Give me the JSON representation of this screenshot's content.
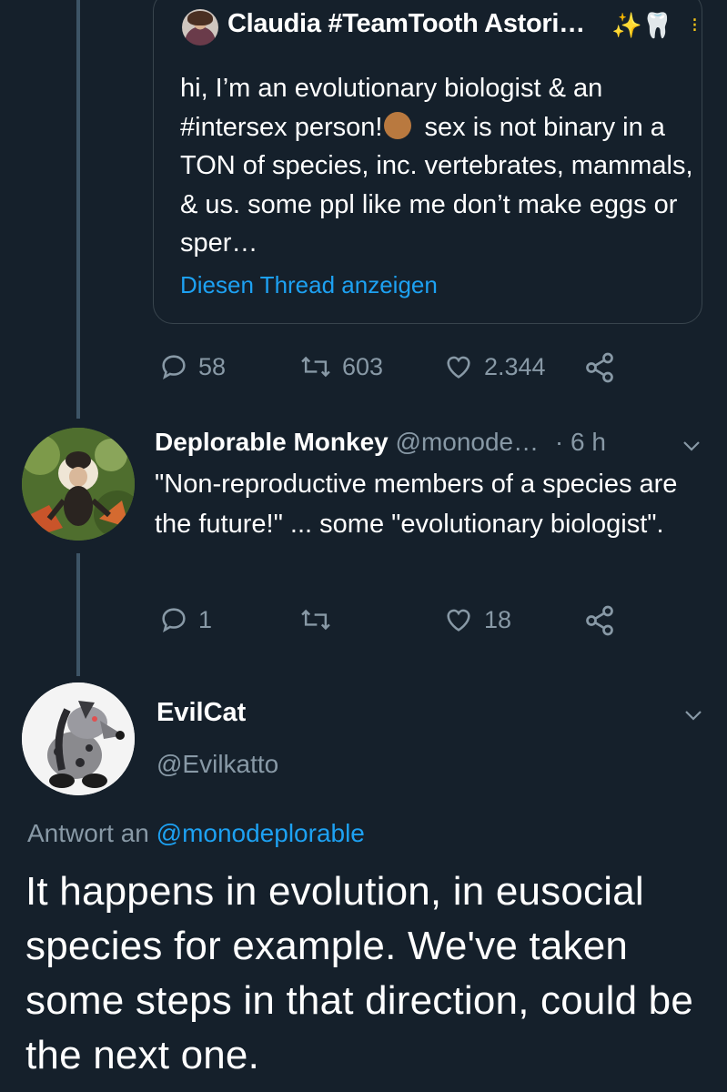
{
  "quoted_tweet": {
    "author_name": "Claudia #TeamTooth Astori…",
    "emoji_after_name": "✨🦷",
    "text": "hi, I’m an evolutionary biologist & an #intersex person!",
    "text_rest": " sex is not binary in a TON of species, inc. vertebrates, mammals, & us. some ppl like me don’t make eggs or sper…",
    "show_thread": "Diesen Thread anzeigen"
  },
  "quoted_actions": {
    "replies": "58",
    "retweets": "603",
    "likes": "2.344"
  },
  "reply_tweet": {
    "author_name": "Deplorable Monkey",
    "handle": "@monode…",
    "time": "· 6 h",
    "text": "\"Non-reproductive members of a species are the future!\" ... some \"evolutionary biologist\".",
    "replies": "1",
    "retweets": "",
    "likes": "18"
  },
  "focused_tweet": {
    "author_name": "EvilCat",
    "handle": "@Evilkatto",
    "reply_prefix": "Antwort an",
    "reply_to": "@monodeplorable",
    "text": "It happens in evolution, in eusocial species for example. We've taken some steps in that direction, could be the next one."
  },
  "colors": {
    "background": "#15202b",
    "text": "#ffffff",
    "muted": "#8899a6",
    "link": "#1da1f2",
    "border": "#38444d"
  },
  "icons": [
    "reply-icon",
    "retweet-icon",
    "like-icon",
    "share-icon",
    "chevron-down-icon"
  ]
}
